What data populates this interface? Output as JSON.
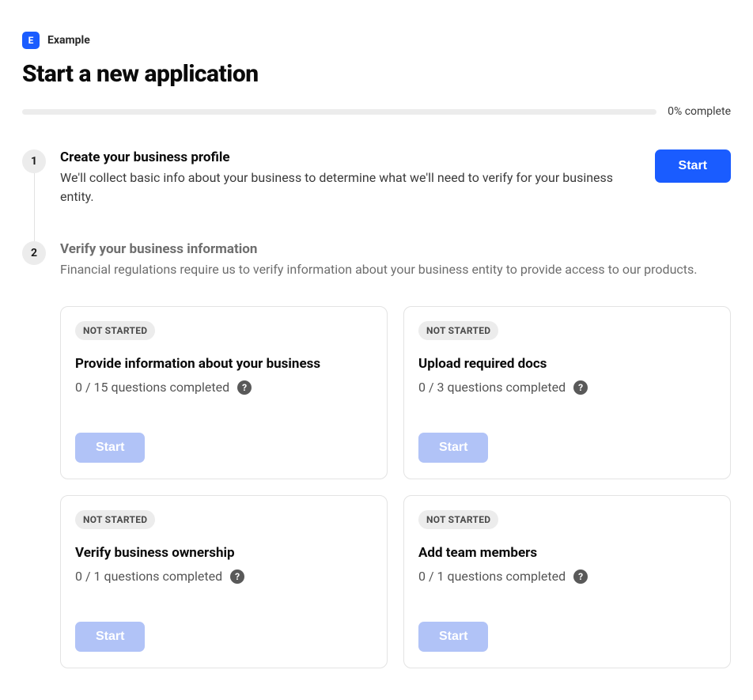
{
  "brand": {
    "initial": "E",
    "name": "Example"
  },
  "page": {
    "title": "Start a new application"
  },
  "progress": {
    "label": "0% complete"
  },
  "steps": [
    {
      "number": "1",
      "heading": "Create your business profile",
      "description": "We'll collect basic info about your business to determine what we'll need to verify for your business entity.",
      "button": "Start"
    },
    {
      "number": "2",
      "heading": "Verify your business information",
      "description": "Financial regulations require us to verify information about your business entity to provide access to our products."
    }
  ],
  "cards": [
    {
      "status": "NOT STARTED",
      "title": "Provide information about your business",
      "subtitle": "0 / 15 questions completed",
      "button": "Start"
    },
    {
      "status": "NOT STARTED",
      "title": "Upload required docs",
      "subtitle": "0 / 3 questions completed",
      "button": "Start"
    },
    {
      "status": "NOT STARTED",
      "title": "Verify business ownership",
      "subtitle": "0 / 1 questions completed",
      "button": "Start"
    },
    {
      "status": "NOT STARTED",
      "title": "Add team members",
      "subtitle": "0 / 1 questions completed",
      "button": "Start"
    }
  ],
  "helpGlyph": "?"
}
